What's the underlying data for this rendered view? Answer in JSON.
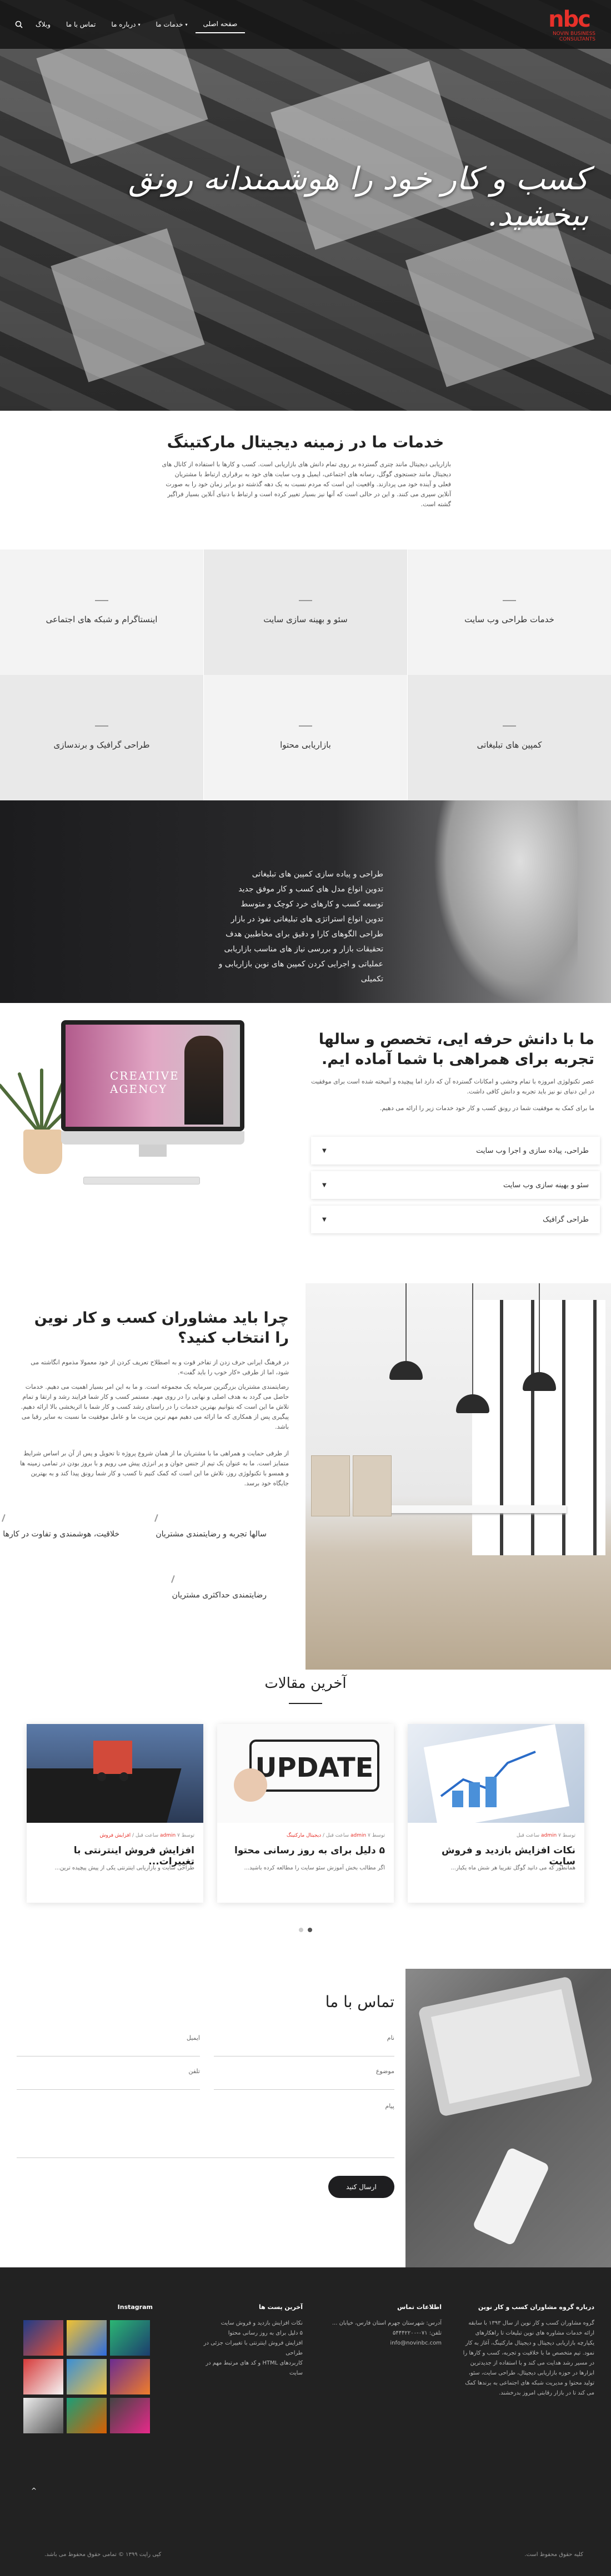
{
  "brand": {
    "logo_text": "nbc",
    "logo_sub": "NOVIN BUSINESS CONSULTANTS",
    "accent": "#e8312a"
  },
  "nav": {
    "items": [
      {
        "label": "صفحه اصلی"
      },
      {
        "label": "خدمات ما"
      },
      {
        "label": "درباره ما"
      },
      {
        "label": "تماس با ما"
      },
      {
        "label": "وبلاگ"
      }
    ],
    "search_icon": "search-icon"
  },
  "hero": {
    "headline": "کسب و کار خود را هوشمندانه رونق ببخشید."
  },
  "services": {
    "title": "خدمات ما در زمینه دیجیتال مارکتینگ",
    "desc": "بازاریابی دیجیتال مانند چتری گسترده بر روی تمام دانش های بازاریابی است. کسب و کارها با استفاده از کانال های دیجیتال مانند جستجوی گوگل، رسانه های اجتماعی، ایمیل و وب سایت های خود به برقراری ارتباط با مشتریان فعلی و آینده خود می پردازند. واقعیت این است که مردم نسبت به یک دهه گذشته دو برابر زمان خود را به صورت آنلاین سپری می کنند. و این در حالی است که آنها نیز بسیار تغییر کرده است و ارتباط با دنیای آنلاین بسیار فراگیر گشته است.",
    "items": [
      {
        "label": "خدمات طراحی وب سایت"
      },
      {
        "label": "سئو و بهینه سازی سایت"
      },
      {
        "label": "اینستاگرام و شبکه های اجتماعی"
      },
      {
        "label": "کمپین های تبلیغاتی"
      },
      {
        "label": "بازاریابی محتوا"
      },
      {
        "label": "طراحی گرافیک و برندسازی"
      }
    ]
  },
  "strategy_list": [
    "طراحی و پیاده سازی کمپین های تبلیغاتی",
    "تدوین انواع مدل های کسب و کار موفق جدید",
    "توسعه کسب و کارهای خرد کوچک و متوسط",
    "تدوین انواع استراتژی های تبلیغاتی نفوذ در بازار",
    "طراحی الگوهای کارا و دقیق برای مخاطبین هدف",
    "تحقیقات بازار و بررسی نیاز های مناسب بازاریابی",
    "عملیاتی و اجرایی کردن کمپین های نوین بازاریابی و تکمیلی"
  ],
  "web": {
    "screen_text": "CREATIVE AGENCY",
    "title": "ما با دانش حرفه ایی، تخصص و سالها تجربه برای همراهی با شما آماده ایم.",
    "p1": "عصر تکنولوژی امروزه با تمام وحشی و امکانات گسترده آن که دارد اما پیچیده و آمیخته شده است برای موفقیت در این دنیای نو نیز باید تجربه و دانش کافی داشت.",
    "p2": "ما برای کمک به موفقیت شما در رونق کسب و کار خود خدمات زیر را ارائه می دهیم.",
    "accordion": [
      {
        "label": "طراحی، پیاده سازی و اجرا وب سایت"
      },
      {
        "label": "سئو و بهینه سازی وب سایت"
      },
      {
        "label": "طراحی گرافیک"
      }
    ]
  },
  "why": {
    "title": "چرا باید مشاوران کسب و کار نوین را انتخاب کنید؟",
    "p1": "در فرهنگ ایرانی حرف زدن از تفاخر قوت و به اصطلاح تعریف کردن از خود معمولا مذموم انگاشته می شود، اما از طرفی «کار خوب را باید گفت».",
    "p2": "رضایتمندی مشتریان بزرگترین سرمایه یک مجموعه است. و ما به این امر بسیار اهمیت می دهیم. خدمات حاصل می گردد به هدف اصلی و نهایی را در روی مهم. مستمر کسب و کار شما فرایند رشد و ارتقا و تمام تلاش ما این است که بتوانیم بهترین خدمات را در راستای رشد کسب و کار شما با اثربخشی بالا ارائه دهیم. پیگیری پس از همکاری که ما ارائه می دهیم مهم ترین مزیت ما و عامل موفقیت ما نسبت به سایر رقبا می باشد.",
    "p3": "از طرفی حمایت و همراهی ما با مشتریان ما از همان شروع پروژه تا تحویل و پس از آن بر اساس شرایط متمایز است. ما به عنوان یک تیم از جنس جوان و پر انرژی پیش می رویم و با بروز بودن در تمامی زمینه ها و همسو با تکنولوژی روز، تلاش ما این است که کمک کنیم تا کسب و کار شما رونق پیدا کند و به بهترین جایگاه خود برسد.",
    "features": [
      {
        "label": "سالها تجربه و رضایتمندی مشتریان"
      },
      {
        "label": "خلاقیت، هوشمندی و تفاوت در کارها"
      },
      {
        "label": "رضایتمندی حداکثری مشتریان"
      }
    ]
  },
  "articles": {
    "title": "آخرین مقالات",
    "cards": [
      {
        "author": "admin",
        "time": "۷ ساعت قبل",
        "category": "",
        "title": "نکات افزایش بازدید و فروش سایت",
        "excerpt": "همانطور که می دانید گوگل تقریبا هر شش ماه یکبار...",
        "img": "chart"
      },
      {
        "author": "admin",
        "time": "۷ ساعت قبل",
        "category": "دیجیتال مارکتینگ",
        "title": "۵ دلیل برای به روز رسانی محتوا",
        "excerpt": "اگر مطالب بخش آموزش سئو سایت را مطالعه کرده باشید...",
        "img": "update"
      },
      {
        "author": "admin",
        "time": "۷ ساعت قبل",
        "category": "افزایش فروش",
        "title": "افزایش فروش اینترنتی با تغییرات...",
        "excerpt": "طراحی سایت و بازاریابی اینترنتی یکی از پیش پیچیده ترین...",
        "img": "laptop"
      }
    ]
  },
  "contact": {
    "title": "تماس با ما",
    "fields": {
      "name": "نام",
      "email": "ایمیل",
      "subject": "موضوع",
      "phone": "تلفن",
      "message": "پیام"
    },
    "send": "ارسال کنید"
  },
  "footer": {
    "about_title": "درباره گروه مشاوران کسب و کار نوین",
    "about_text": "گروه مشاوران کسب و کار نوین از سال ۱۳۹۳ با سابقه ارائه خدمات مشاوره های نوین تبلیغات تا راهکارهای یکپارچه بازاریابی دیجیتال و دیجیتال مارکتینگ، آغاز به کار نمود. تیم متخصص ما با خلاقیت و تجربه، کسب و کارها را در مسیر رشد هدایت می کند و با استفاده از جدیدترین ابزارها در حوزه بازاریابی دیجیتال، طراحی سایت، سئو، تولید محتوا و مدیریت شبکه های اجتماعی به برندها کمک می کند تا در بازار رقابتی امروز بدرخشند.",
    "contact_title": "اطلاعات تماس",
    "contact_lines": [
      "آدرس: شهرستان جهرم استان فارس، خیابان ...",
      "تلفن: ۰۷۱-۵۴۴۴۲۲۰۰",
      "info@novinbc.com"
    ],
    "posts_title": "آخرین پست ها",
    "posts": [
      "نکات افزایش بازدید و فروش سایت",
      "۵ دلیل برای به روز رسانی محتوا",
      "افزایش فروش اینترنتی با تغییرات جزئی در طراحی",
      "کاربردهای HTML و کد های مرتبط مهم در سایت"
    ],
    "insta_title": "Instagram",
    "copy_right": "کلیه حقوق محفوظ است.",
    "copy_left": "کپی رایت ۱۳۹۹ © تمامی حقوق محفوظ می باشد.",
    "totop": "^"
  }
}
